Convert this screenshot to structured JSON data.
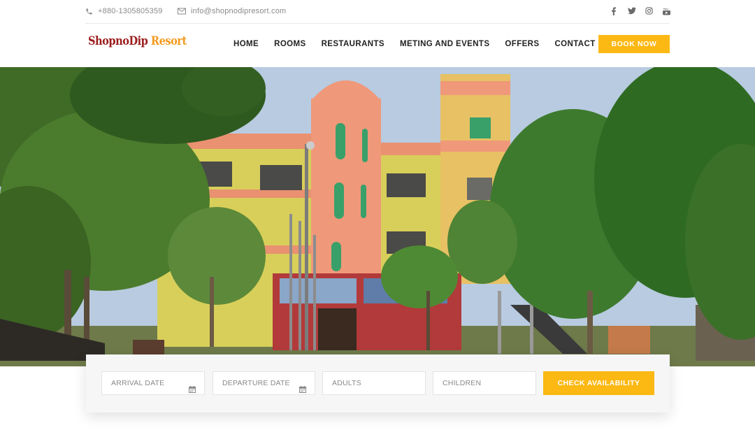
{
  "topbar": {
    "phone": "+880-1305805359",
    "email": "info@shopnodipresort.com",
    "social": [
      "facebook-icon",
      "twitter-icon",
      "instagram-icon",
      "youtube-icon"
    ]
  },
  "brand": {
    "name_part1": "ShopnoDip",
    "name_part2": "Resort"
  },
  "nav": {
    "items": [
      "HOME",
      "ROOMS",
      "RESTAURANTS",
      "METING AND EVENTS",
      "OFFERS",
      "CONTACT"
    ],
    "book_label": "BOOK NOW"
  },
  "booking": {
    "arrival_placeholder": "ARRIVAL DATE",
    "departure_placeholder": "DEPARTURE DATE",
    "adults_placeholder": "ADULTS",
    "children_placeholder": "CHILDREN",
    "check_label": "CHECK AVAILABILITY"
  },
  "colors": {
    "accent": "#fcb813",
    "brand_red": "#9b1d1d",
    "brand_orange": "#f39a1c"
  }
}
